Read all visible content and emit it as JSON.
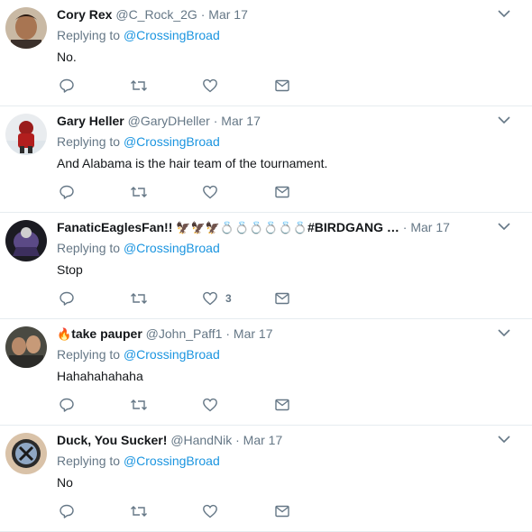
{
  "colors": {
    "link": "#1b95e0",
    "muted": "#657786",
    "text": "#14171a",
    "divider": "#e6ecf0"
  },
  "replies": [
    {
      "name": "Cory Rex",
      "handle": "@C_Rock_2G",
      "date": "Mar 17",
      "replying_prefix": "Replying to ",
      "replying_to": "@CrossingBroad",
      "text": "No.",
      "like_count": ""
    },
    {
      "name": "Gary Heller",
      "handle": "@GaryDHeller",
      "date": "Mar 17",
      "replying_prefix": "Replying to ",
      "replying_to": "@CrossingBroad",
      "text": "And Alabama is the hair team of the tournament.",
      "like_count": ""
    },
    {
      "name": "FanaticEaglesFan!!",
      "name_emoji": "🦅🦅🦅💍💍💍💍💍💍",
      "name_suffix": "#BIRDGANG …",
      "handle": "",
      "date": "Mar 17",
      "replying_prefix": "Replying to ",
      "replying_to": "@CrossingBroad",
      "text": "Stop",
      "like_count": "3"
    },
    {
      "name_emoji_prefix": "🔥",
      "name": "take pauper",
      "handle": "@John_Paff1",
      "date": "Mar 17",
      "replying_prefix": "Replying to ",
      "replying_to": "@CrossingBroad",
      "text": "Hahahahahaha",
      "like_count": ""
    },
    {
      "name": "Duck, You Sucker!",
      "handle": "@HandNik",
      "date": "Mar 17",
      "replying_prefix": "Replying to ",
      "replying_to": "@CrossingBroad",
      "text": "No",
      "like_count": ""
    }
  ],
  "separator": "·"
}
